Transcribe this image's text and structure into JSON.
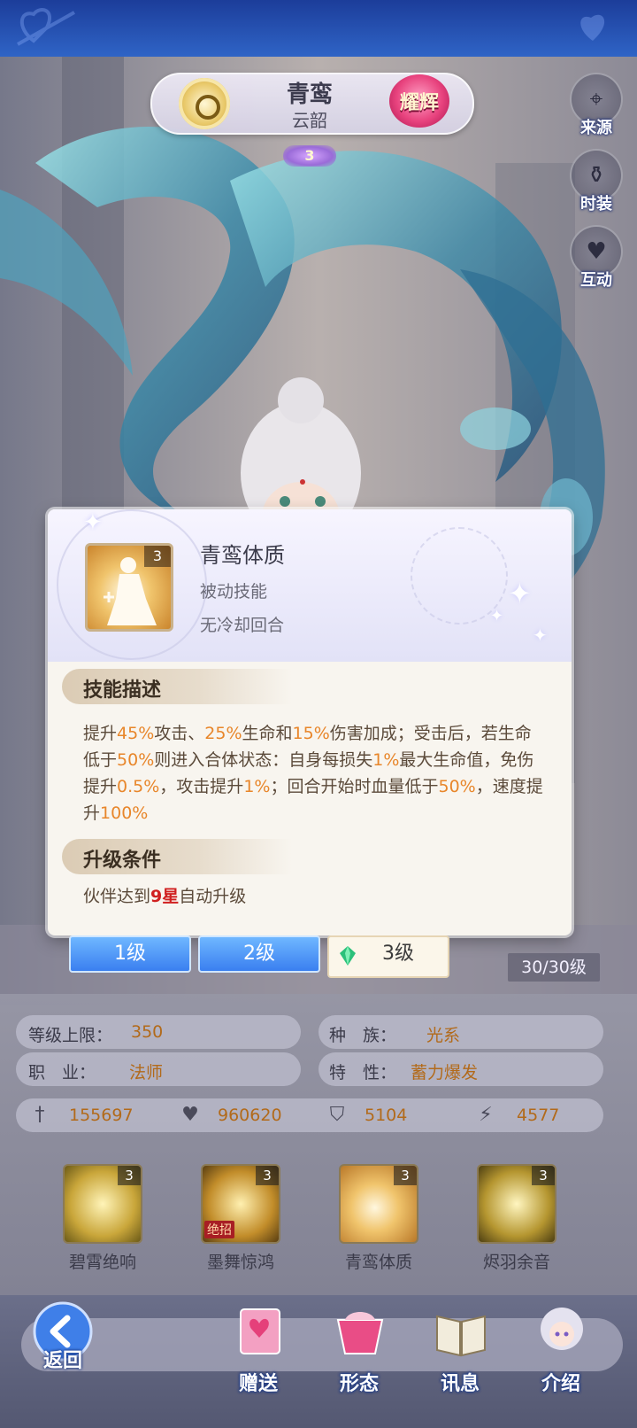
{
  "hero": {
    "name": "青鸾",
    "subtitle": "云韶",
    "rank_label": "耀辉",
    "star_level": "3"
  },
  "side_buttons": [
    {
      "label": "来源",
      "icon": "location-pin-icon"
    },
    {
      "label": "时装",
      "icon": "vase-icon"
    },
    {
      "label": "互动",
      "icon": "heart-icon"
    }
  ],
  "popup": {
    "skill_name": "青鸾体质",
    "skill_type": "被动技能",
    "cooldown": "无冷却回合",
    "icon_level": "3",
    "desc_header": "技能描述",
    "desc_parts": [
      {
        "t": "提升",
        "hl": false
      },
      {
        "t": "45%",
        "hl": true
      },
      {
        "t": "攻击、",
        "hl": false
      },
      {
        "t": "25%",
        "hl": true
      },
      {
        "t": "生命和",
        "hl": false
      },
      {
        "t": "15%",
        "hl": true
      },
      {
        "t": "伤害加成；受击后，若生命低于",
        "hl": false
      },
      {
        "t": "50%",
        "hl": true
      },
      {
        "t": "则进入合体状态：自身每损失",
        "hl": false
      },
      {
        "t": "1%",
        "hl": true
      },
      {
        "t": "最大生命值，免伤提升",
        "hl": false
      },
      {
        "t": "0.5%",
        "hl": true
      },
      {
        "t": "，攻击提升",
        "hl": false
      },
      {
        "t": "1%",
        "hl": true
      },
      {
        "t": "；回合开始时血量低于",
        "hl": false
      },
      {
        "t": "50%",
        "hl": true
      },
      {
        "t": "，速度提升",
        "hl": false
      },
      {
        "t": "100%",
        "hl": true
      }
    ],
    "upgrade_header": "升级条件",
    "upgrade_prefix": "伙伴达到",
    "upgrade_highlight": "9星",
    "upgrade_suffix": "自动升级"
  },
  "level_tabs": [
    "1级",
    "2级",
    "3级"
  ],
  "level_count": "30/30级",
  "stats": {
    "level_cap_label": "等级上限：",
    "level_cap_value": "350",
    "race_label": "种　族：",
    "race_value": "光系",
    "job_label": "职　业：",
    "job_value": "法师",
    "trait_label": "特　性：",
    "trait_value": "蓄力爆发",
    "attack": "155697",
    "hp": "960620",
    "defense": "5104",
    "speed": "4577"
  },
  "skills": [
    {
      "name": "碧霄绝响",
      "level": "3",
      "tag": "",
      "color": "#c9a63a"
    },
    {
      "name": "墨舞惊鸿",
      "level": "3",
      "tag": "绝招",
      "color": "#c28d2a"
    },
    {
      "name": "青鸾体质",
      "level": "3",
      "tag": "",
      "color": "#d0903a"
    },
    {
      "name": "烬羽余音",
      "level": "3",
      "tag": "",
      "color": "#b59630"
    }
  ],
  "nav": {
    "back": "返回",
    "items": [
      "赠送",
      "形态",
      "讯息",
      "介绍"
    ]
  },
  "colors": {
    "accent_orange": "#e8862a",
    "tab_blue": "#3a7ff0",
    "topbar_blue": "#2f64c6"
  }
}
